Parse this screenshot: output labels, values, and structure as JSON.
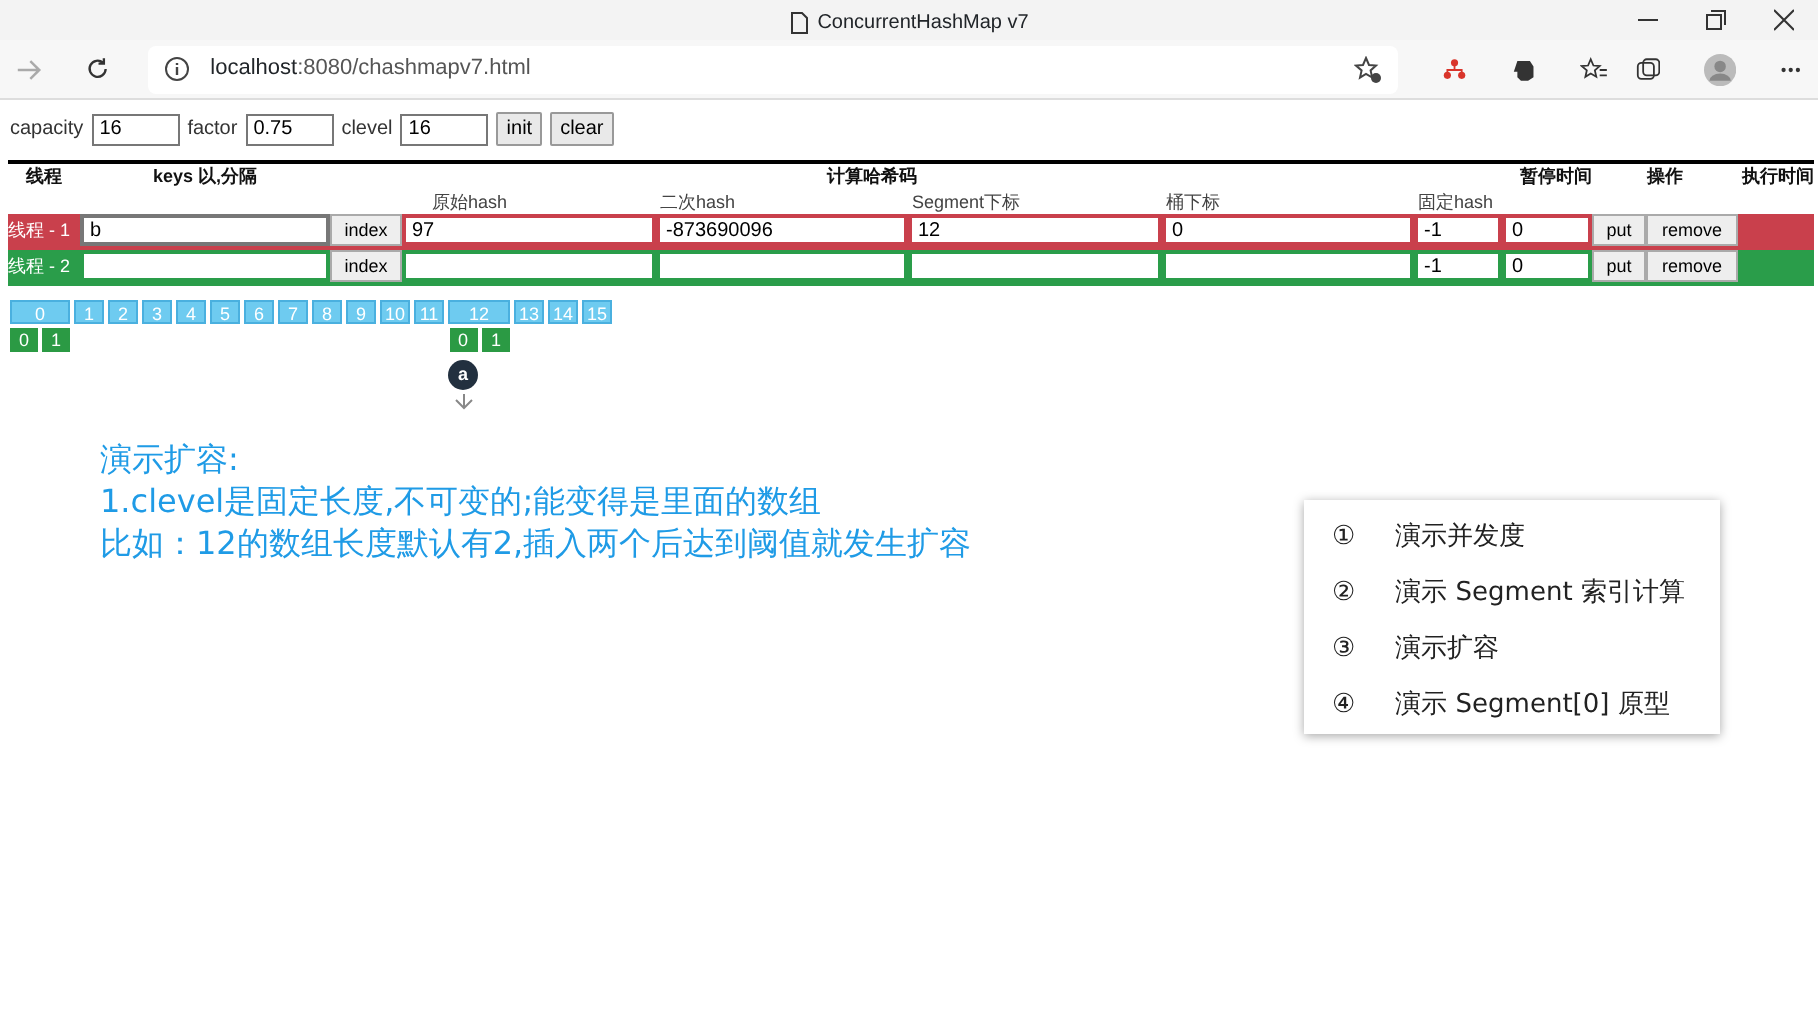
{
  "window": {
    "title": "ConcurrentHashMap v7",
    "url_host": "localhost",
    "url_path": ":8080/chashmapv7.html"
  },
  "config": [
    {
      "label": "capacity",
      "value": "16"
    },
    {
      "label": "factor",
      "value": "0.75"
    },
    {
      "label": "clevel",
      "value": "16"
    }
  ],
  "config_buttons": [
    "init",
    "clear"
  ],
  "table": {
    "headers": [
      "线程",
      "keys 以,分隔",
      "计算哈希码",
      "暂停时间",
      "操作",
      "执行时间"
    ],
    "subheaders": [
      "原始hash",
      "二次hash",
      "Segment下标",
      "桶下标",
      "固定hash"
    ]
  },
  "threads": [
    {
      "name": "线程 - 1",
      "color": "#c9404c",
      "keys": "b",
      "index_button": "index",
      "original_hash": "97",
      "second_hash": "-873690096",
      "segment_index": "12",
      "bucket_index": "0",
      "fixed_hash": "-1",
      "pause": "0",
      "put_button": "put",
      "remove_button": "remove"
    },
    {
      "name": "线程 - 2",
      "color": "#2a9d4a",
      "index_button": "index",
      "fixed_hash": "-1",
      "pause": "0",
      "put_button": "put",
      "remove_button": "remove"
    }
  ],
  "segments": [
    {
      "label": "0",
      "buckets": [
        {
          "label": "0"
        },
        {
          "label": "1"
        }
      ]
    },
    {
      "label": "1"
    },
    {
      "label": "2"
    },
    {
      "label": "3"
    },
    {
      "label": "4"
    },
    {
      "label": "5"
    },
    {
      "label": "6"
    },
    {
      "label": "7"
    },
    {
      "label": "8"
    },
    {
      "label": "9"
    },
    {
      "label": "10"
    },
    {
      "label": "11"
    },
    {
      "label": "12",
      "buckets": [
        {
          "label": "0",
          "nodes": [
            "a"
          ]
        },
        {
          "label": "1"
        }
      ]
    },
    {
      "label": "13"
    },
    {
      "label": "14"
    },
    {
      "label": "15"
    }
  ],
  "note": [
    "演示扩容:",
    "1.clevel是固定长度,不可变的;能变得是里面的数组",
    "比如：12的数组长度默认有2,插入两个后达到阈值就发生扩容"
  ],
  "menu": [
    {
      "marker": "①",
      "label": "演示并发度"
    },
    {
      "marker": "②",
      "label": "演示 Segment 索引计算"
    },
    {
      "marker": "③",
      "label": "演示扩容"
    },
    {
      "marker": "④",
      "label": "演示 Segment[0] 原型"
    }
  ]
}
